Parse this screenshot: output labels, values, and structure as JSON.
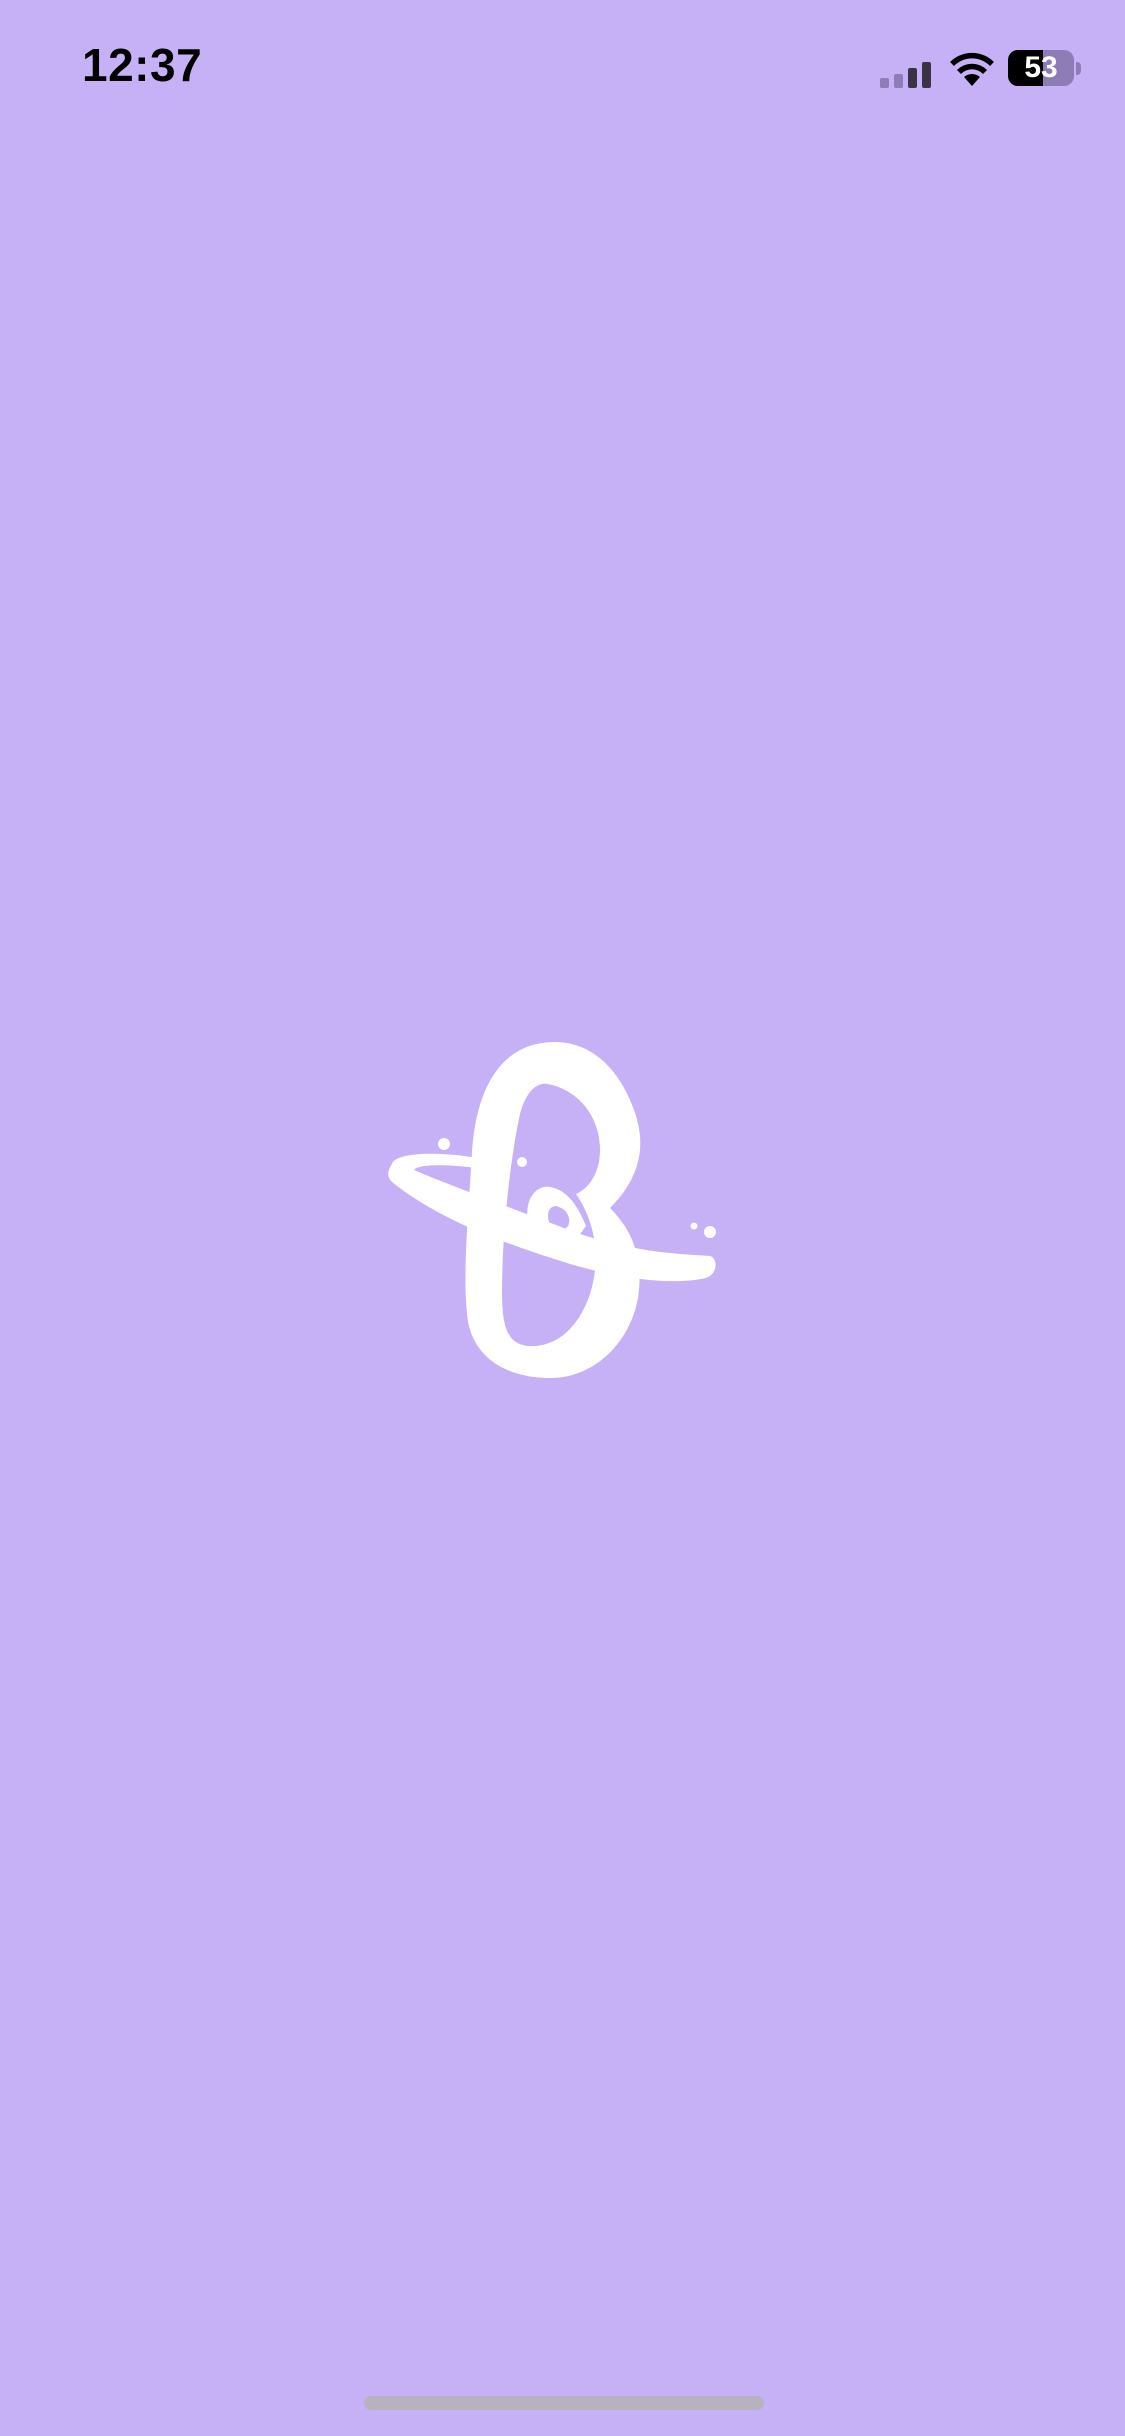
{
  "status_bar": {
    "time": "12:37",
    "battery_level": "53",
    "battery_percent": 53,
    "signal_bars_active": 2,
    "signal_bars_total": 4,
    "icons": [
      "signal-icon",
      "wifi-icon",
      "battery-icon"
    ]
  },
  "splash": {
    "logo_icon": "app-logo-icon",
    "background_color": "#c6b1f7",
    "logo_color": "#ffffff"
  }
}
